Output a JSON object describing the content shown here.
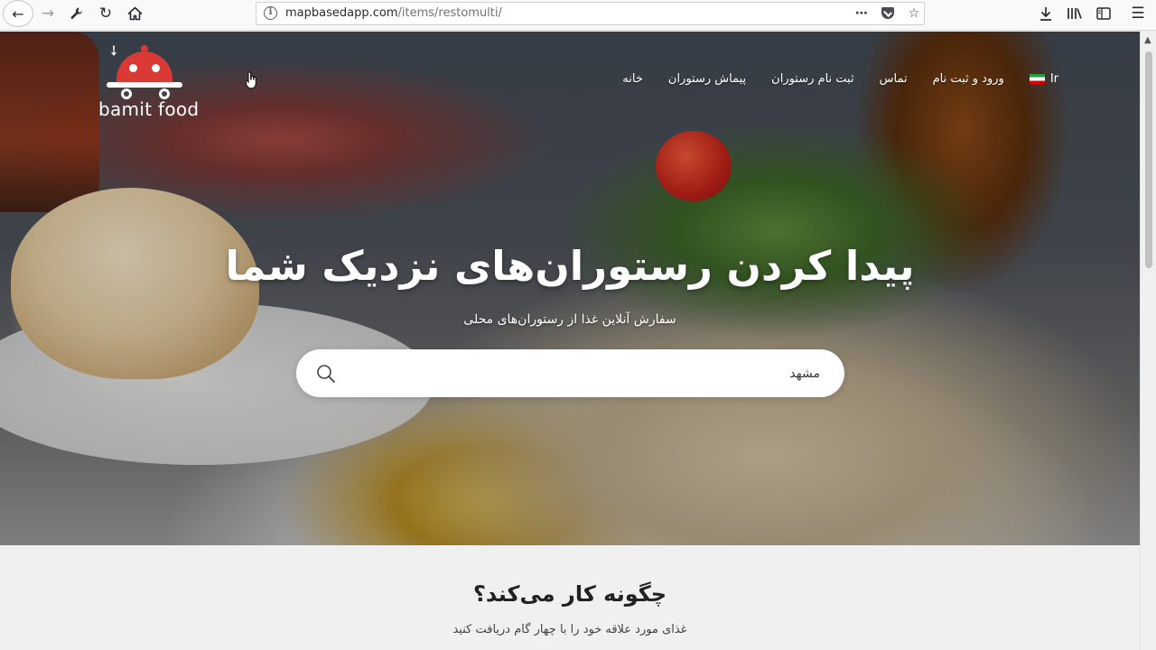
{
  "browser": {
    "url_domain": "mapbasedapp.com",
    "url_path": "/items/restomulti/",
    "page_actions_icon": "⋯"
  },
  "logo": {
    "text": "bamit food"
  },
  "nav": {
    "items": [
      "خانه",
      "پیماش رستوران",
      "ثبت نام رستوران",
      "تماس",
      "ورود و ثبت نام"
    ],
    "language": "Ir"
  },
  "hero": {
    "title": "پیدا کردن رستوران‌های نزدیک شما",
    "subtitle": "سفارش آنلاین غذا از رستوران‌های محلی",
    "search_value": "مشهد"
  },
  "how": {
    "title": "چگونه کار می‌کند؟",
    "subtitle": "غذای مورد علاقه خود را با چهار گام دریافت کنید"
  },
  "colors": {
    "logo_red": "#d93a35",
    "toolbar_bg": "#f9f9fa",
    "section_bg": "#f0f0f0"
  }
}
